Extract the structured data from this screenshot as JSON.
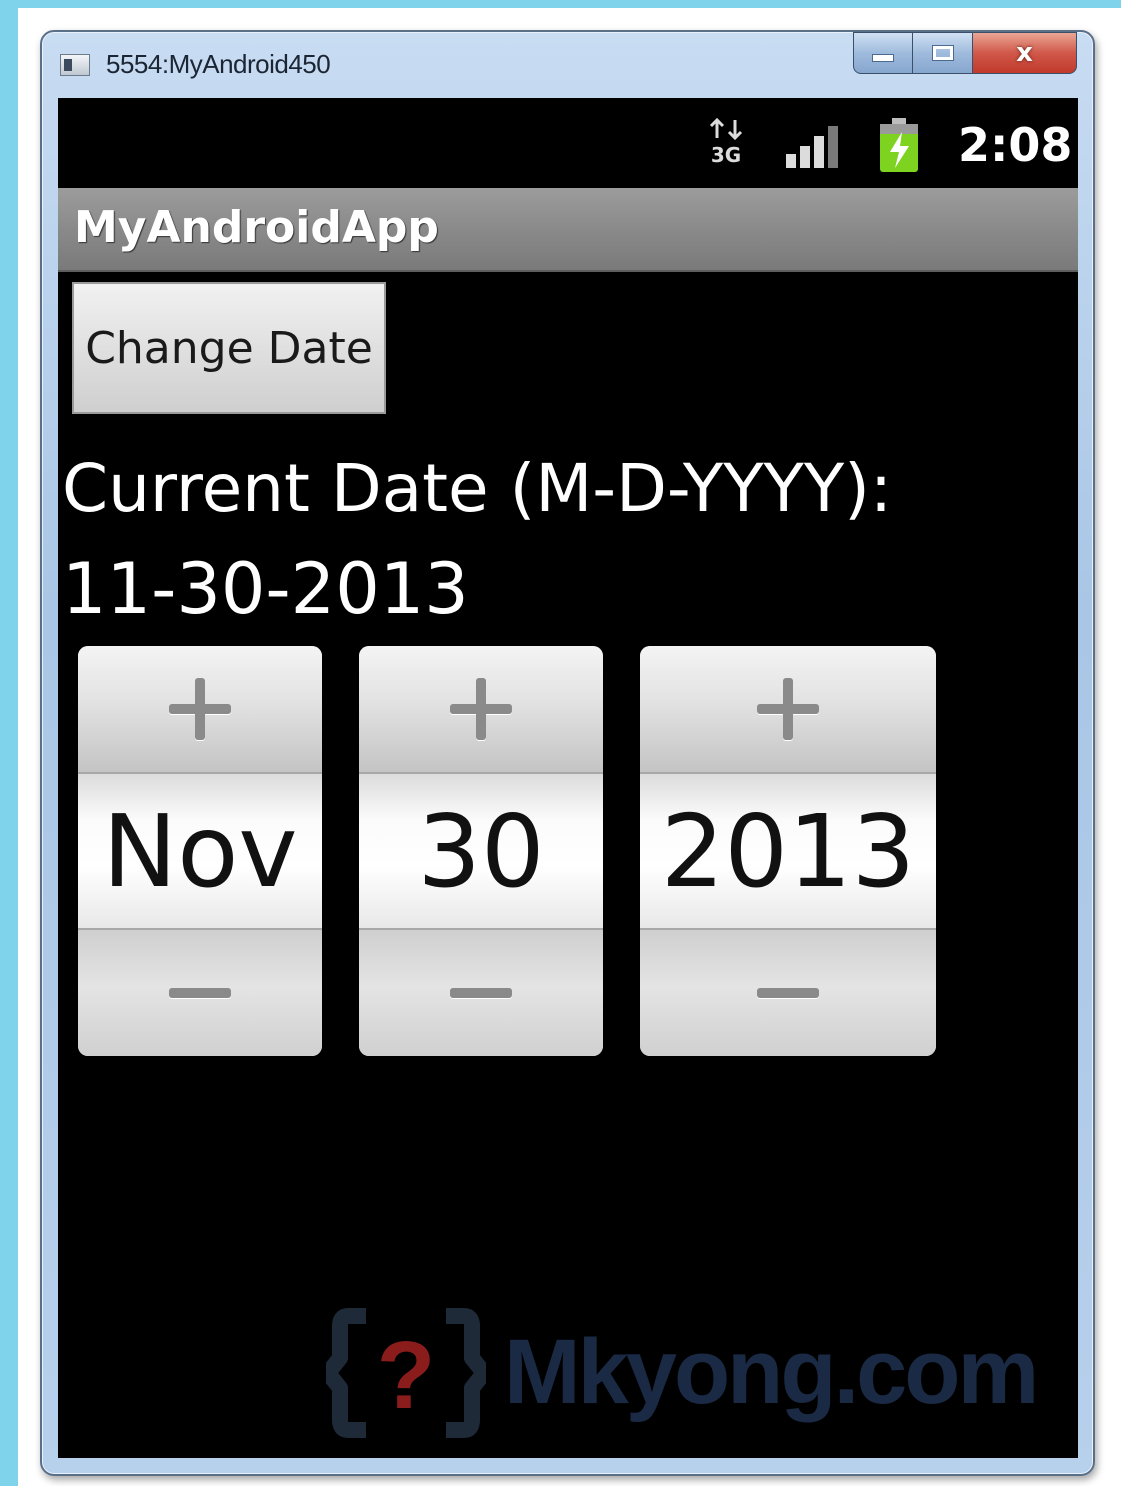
{
  "window": {
    "title": "5554:MyAndroid450",
    "close_label": "x"
  },
  "statusbar": {
    "network": "3G",
    "time": "2:08",
    "battery_color": "#7ed321"
  },
  "app": {
    "title": "MyAndroidApp",
    "change_date_button": "Change Date",
    "date_label": "Current Date (M-D-YYYY):",
    "date_value": "11-30-2013"
  },
  "date_picker": {
    "month": "Nov",
    "day": "30",
    "year": "2013"
  },
  "watermark": {
    "text": "Mkyong",
    "suffix": ".com"
  }
}
